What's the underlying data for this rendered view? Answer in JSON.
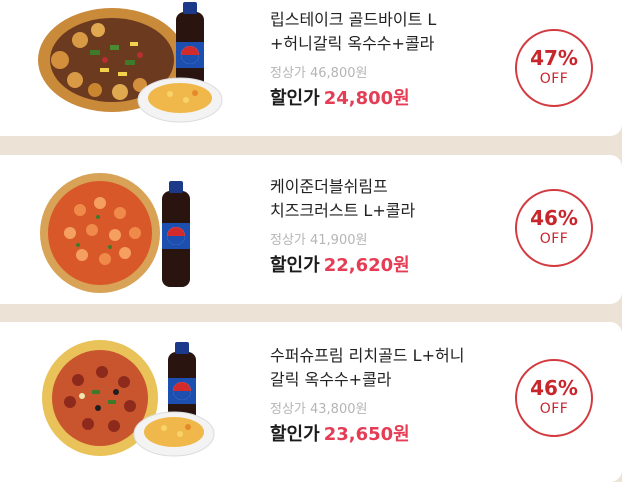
{
  "products": [
    {
      "name": "립스테이크 골드바이트 L\n+허니갈릭 옥수수+콜라",
      "original_price": "정상가 46,800원",
      "sale_label": "할인가",
      "sale_price": "24,800원",
      "discount_percent": "47%",
      "discount_label": "OFF"
    },
    {
      "name": "케이준더블쉬림프\n치즈크러스트 L+콜라",
      "original_price": "정상가 41,900원",
      "sale_label": "할인가",
      "sale_price": "22,620원",
      "discount_percent": "46%",
      "discount_label": "OFF"
    },
    {
      "name": "수퍼슈프림 리치골드 L+허니\n갈릭 옥수수+콜라",
      "original_price": "정상가 43,800원",
      "sale_label": "할인가",
      "sale_price": "23,650원",
      "discount_percent": "46%",
      "discount_label": "OFF"
    }
  ],
  "colors": {
    "page_background": "#ece3d6",
    "card_background": "#ffffff",
    "sale_price": "#e43d55",
    "badge": "#c8262d",
    "original_price": "#b5b5b5"
  },
  "icons": [
    "pizza-image",
    "cola-bottle-icon",
    "side-dish-image"
  ]
}
